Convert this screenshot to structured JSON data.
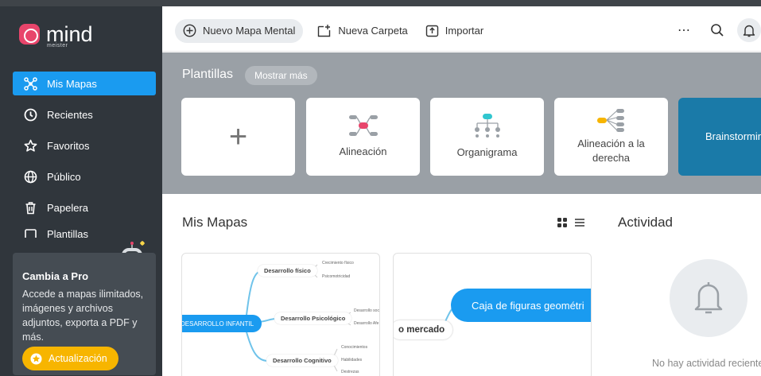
{
  "app": {
    "logo_text": "mind",
    "logo_sub": "meister"
  },
  "sidebar": {
    "items": [
      {
        "label": "Mis Mapas",
        "icon": "mindmap-icon",
        "active": true
      },
      {
        "label": "Recientes",
        "icon": "clock-icon"
      },
      {
        "label": "Favoritos",
        "icon": "star-icon"
      },
      {
        "label": "Público",
        "icon": "globe-icon"
      },
      {
        "label": "Papelera",
        "icon": "trash-icon"
      },
      {
        "label": "Plantillas",
        "icon": "template-icon"
      }
    ],
    "promo": {
      "title": "Cambia a Pro",
      "text": "Accede a mapas ilimitados, imágenes y archivos adjuntos, exporta a PDF y más.",
      "button": "Actualización"
    }
  },
  "toolbar": {
    "new_map": "Nuevo Mapa Mental",
    "new_folder": "Nueva Carpeta",
    "import": "Importar",
    "more": "⋯"
  },
  "templates": {
    "title": "Plantillas",
    "show_more": "Mostrar más",
    "cards": [
      {
        "label": "+"
      },
      {
        "label": "Alineación"
      },
      {
        "label": "Organigrama"
      },
      {
        "label": "Alineación a la derecha"
      },
      {
        "label": "Brainstorming"
      }
    ]
  },
  "maps": {
    "title": "Mis Mapas",
    "map1": {
      "root": "DESARROLLO INFANTIL",
      "nodes": [
        "Desarrollo físico",
        "Desarrollo Psicológico",
        "Desarrollo Cognitivo"
      ],
      "leaves": [
        "Crecimiento físico",
        "Psicomotricidad",
        "Desarrollo soc",
        "Desarrollo Afe",
        "Conocimientos",
        "Habilidades",
        "Destrezas"
      ]
    },
    "map2": {
      "root": "Caja de figuras geométri",
      "node": "o mercado"
    }
  },
  "activity": {
    "title": "Actividad",
    "empty": "No hay actividad reciente"
  },
  "colors": {
    "accent": "#1a9bf0",
    "sidebar": "#30363c",
    "upgrade": "#f7b500",
    "brand": "#e8456b"
  }
}
